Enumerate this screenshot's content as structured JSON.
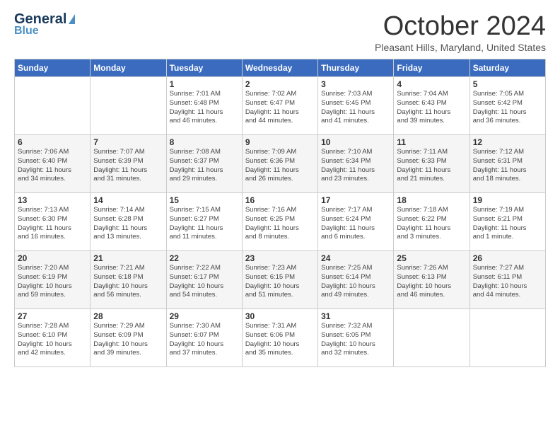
{
  "header": {
    "logo_line1": "General",
    "logo_line2": "Blue",
    "month_title": "October 2024",
    "location": "Pleasant Hills, Maryland, United States"
  },
  "days_of_week": [
    "Sunday",
    "Monday",
    "Tuesday",
    "Wednesday",
    "Thursday",
    "Friday",
    "Saturday"
  ],
  "weeks": [
    [
      {
        "day": "",
        "info": ""
      },
      {
        "day": "",
        "info": ""
      },
      {
        "day": "1",
        "info": "Sunrise: 7:01 AM\nSunset: 6:48 PM\nDaylight: 11 hours\nand 46 minutes."
      },
      {
        "day": "2",
        "info": "Sunrise: 7:02 AM\nSunset: 6:47 PM\nDaylight: 11 hours\nand 44 minutes."
      },
      {
        "day": "3",
        "info": "Sunrise: 7:03 AM\nSunset: 6:45 PM\nDaylight: 11 hours\nand 41 minutes."
      },
      {
        "day": "4",
        "info": "Sunrise: 7:04 AM\nSunset: 6:43 PM\nDaylight: 11 hours\nand 39 minutes."
      },
      {
        "day": "5",
        "info": "Sunrise: 7:05 AM\nSunset: 6:42 PM\nDaylight: 11 hours\nand 36 minutes."
      }
    ],
    [
      {
        "day": "6",
        "info": "Sunrise: 7:06 AM\nSunset: 6:40 PM\nDaylight: 11 hours\nand 34 minutes."
      },
      {
        "day": "7",
        "info": "Sunrise: 7:07 AM\nSunset: 6:39 PM\nDaylight: 11 hours\nand 31 minutes."
      },
      {
        "day": "8",
        "info": "Sunrise: 7:08 AM\nSunset: 6:37 PM\nDaylight: 11 hours\nand 29 minutes."
      },
      {
        "day": "9",
        "info": "Sunrise: 7:09 AM\nSunset: 6:36 PM\nDaylight: 11 hours\nand 26 minutes."
      },
      {
        "day": "10",
        "info": "Sunrise: 7:10 AM\nSunset: 6:34 PM\nDaylight: 11 hours\nand 23 minutes."
      },
      {
        "day": "11",
        "info": "Sunrise: 7:11 AM\nSunset: 6:33 PM\nDaylight: 11 hours\nand 21 minutes."
      },
      {
        "day": "12",
        "info": "Sunrise: 7:12 AM\nSunset: 6:31 PM\nDaylight: 11 hours\nand 18 minutes."
      }
    ],
    [
      {
        "day": "13",
        "info": "Sunrise: 7:13 AM\nSunset: 6:30 PM\nDaylight: 11 hours\nand 16 minutes."
      },
      {
        "day": "14",
        "info": "Sunrise: 7:14 AM\nSunset: 6:28 PM\nDaylight: 11 hours\nand 13 minutes."
      },
      {
        "day": "15",
        "info": "Sunrise: 7:15 AM\nSunset: 6:27 PM\nDaylight: 11 hours\nand 11 minutes."
      },
      {
        "day": "16",
        "info": "Sunrise: 7:16 AM\nSunset: 6:25 PM\nDaylight: 11 hours\nand 8 minutes."
      },
      {
        "day": "17",
        "info": "Sunrise: 7:17 AM\nSunset: 6:24 PM\nDaylight: 11 hours\nand 6 minutes."
      },
      {
        "day": "18",
        "info": "Sunrise: 7:18 AM\nSunset: 6:22 PM\nDaylight: 11 hours\nand 3 minutes."
      },
      {
        "day": "19",
        "info": "Sunrise: 7:19 AM\nSunset: 6:21 PM\nDaylight: 11 hours\nand 1 minute."
      }
    ],
    [
      {
        "day": "20",
        "info": "Sunrise: 7:20 AM\nSunset: 6:19 PM\nDaylight: 10 hours\nand 59 minutes."
      },
      {
        "day": "21",
        "info": "Sunrise: 7:21 AM\nSunset: 6:18 PM\nDaylight: 10 hours\nand 56 minutes."
      },
      {
        "day": "22",
        "info": "Sunrise: 7:22 AM\nSunset: 6:17 PM\nDaylight: 10 hours\nand 54 minutes."
      },
      {
        "day": "23",
        "info": "Sunrise: 7:23 AM\nSunset: 6:15 PM\nDaylight: 10 hours\nand 51 minutes."
      },
      {
        "day": "24",
        "info": "Sunrise: 7:25 AM\nSunset: 6:14 PM\nDaylight: 10 hours\nand 49 minutes."
      },
      {
        "day": "25",
        "info": "Sunrise: 7:26 AM\nSunset: 6:13 PM\nDaylight: 10 hours\nand 46 minutes."
      },
      {
        "day": "26",
        "info": "Sunrise: 7:27 AM\nSunset: 6:11 PM\nDaylight: 10 hours\nand 44 minutes."
      }
    ],
    [
      {
        "day": "27",
        "info": "Sunrise: 7:28 AM\nSunset: 6:10 PM\nDaylight: 10 hours\nand 42 minutes."
      },
      {
        "day": "28",
        "info": "Sunrise: 7:29 AM\nSunset: 6:09 PM\nDaylight: 10 hours\nand 39 minutes."
      },
      {
        "day": "29",
        "info": "Sunrise: 7:30 AM\nSunset: 6:07 PM\nDaylight: 10 hours\nand 37 minutes."
      },
      {
        "day": "30",
        "info": "Sunrise: 7:31 AM\nSunset: 6:06 PM\nDaylight: 10 hours\nand 35 minutes."
      },
      {
        "day": "31",
        "info": "Sunrise: 7:32 AM\nSunset: 6:05 PM\nDaylight: 10 hours\nand 32 minutes."
      },
      {
        "day": "",
        "info": ""
      },
      {
        "day": "",
        "info": ""
      }
    ]
  ]
}
